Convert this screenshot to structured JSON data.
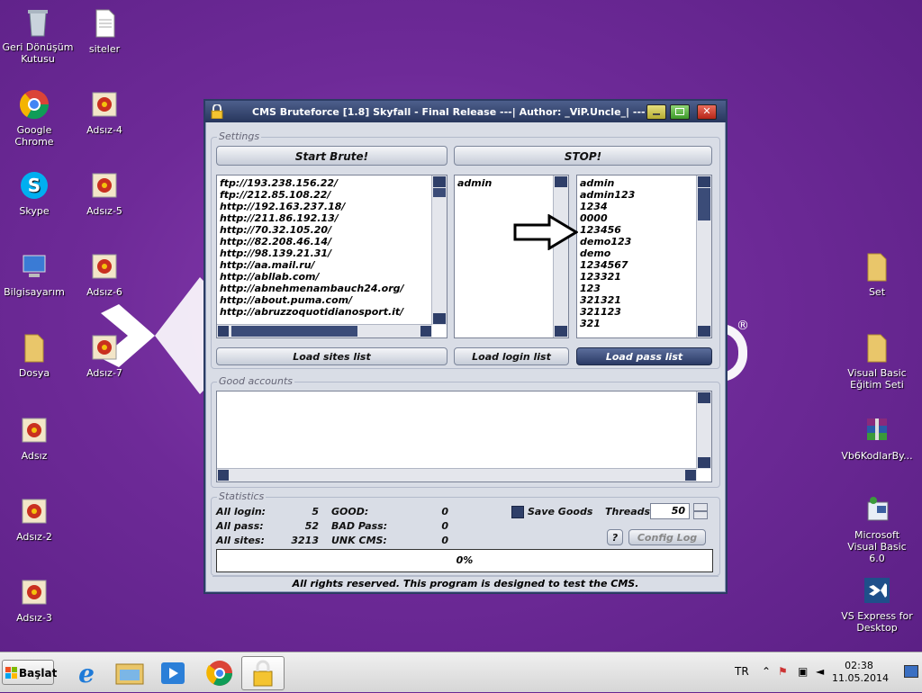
{
  "desktop": {
    "icons_left": [
      {
        "label": "Geri Dönüşüm Kutusu",
        "icon": "recycle-bin-icon"
      },
      {
        "label": "Google Chrome",
        "icon": "chrome-icon"
      },
      {
        "label": "Skype",
        "icon": "skype-icon"
      },
      {
        "label": "Bilgisayarım",
        "icon": "computer-icon"
      },
      {
        "label": "Dosya",
        "icon": "folder-icon"
      },
      {
        "label": "Adsız",
        "icon": "image-icon"
      },
      {
        "label": "Adsız-2",
        "icon": "image-icon"
      },
      {
        "label": "Adsız-3",
        "icon": "image-icon"
      }
    ],
    "icons_col2": [
      {
        "label": "siteler",
        "icon": "text-file-icon"
      },
      {
        "label": "Adsız-4",
        "icon": "image-icon"
      },
      {
        "label": "Adsız-5",
        "icon": "image-icon"
      },
      {
        "label": "Adsız-6",
        "icon": "image-icon"
      },
      {
        "label": "Adsız-7",
        "icon": "image-icon"
      }
    ],
    "icons_right": [
      {
        "label": "Set",
        "icon": "folder-icon"
      },
      {
        "label": "Visual Basic Eğitim Seti",
        "icon": "folder-icon"
      },
      {
        "label": "Vb6KodlarBy...",
        "icon": "winrar-icon"
      },
      {
        "label": "Microsoft Visual Basic 6.0",
        "icon": "vb6-icon"
      },
      {
        "label": "VS Express for Desktop",
        "icon": "vs-icon"
      }
    ],
    "reg_mark": "®"
  },
  "window": {
    "title": "CMS Bruteforce [1.8] Skyfall - Final Release ---| Author: _ViP.Uncle_| ---",
    "settings_group": "Settings",
    "start_button": "Start Brute!",
    "stop_button": "STOP!",
    "sites": [
      "ftp://193.238.156.22/",
      "ftp://212.85.108.22/",
      "http://192.163.237.18/",
      "http://211.86.192.13/",
      "http://70.32.105.20/",
      "http://82.208.46.14/",
      "http://98.139.21.31/",
      "http://aa.mail.ru/",
      "http://abllab.com/",
      "http://abnehmenambauch24.org/",
      "http://about.puma.com/",
      "http://abruzzoquotidianosport.it/"
    ],
    "logins": [
      "admin"
    ],
    "passwords": [
      "admin",
      "admin123",
      "1234",
      "0000",
      "123456",
      "demo123",
      "demo",
      "1234567",
      "123321",
      "123",
      "321321",
      "321123",
      "321"
    ],
    "load_sites_button": "Load sites list",
    "load_login_button": "Load login list",
    "load_pass_button": "Load pass list",
    "good_accounts_group": "Good accounts",
    "statistics_group": "Statistics",
    "stats": {
      "all_login_label": "All login:",
      "all_login_value": "5",
      "all_pass_label": "All pass:",
      "all_pass_value": "52",
      "all_sites_label": "All sites:",
      "all_sites_value": "3213",
      "good_label": "GOOD:",
      "good_value": "0",
      "bad_pass_label": "BAD Pass:",
      "bad_pass_value": "0",
      "unk_cms_label": "UNK CMS:",
      "unk_cms_value": "0"
    },
    "save_goods_label": "Save Goods",
    "threads_label": "Threads",
    "threads_value": "50",
    "help_button": "?",
    "config_log_button": "Config Log",
    "progress_text": "0%",
    "footer": "All rights reserved. This program is designed to test the CMS."
  },
  "taskbar": {
    "start_label": "Başlat",
    "language": "TR",
    "time": "02:38",
    "date": "11.05.2014"
  }
}
